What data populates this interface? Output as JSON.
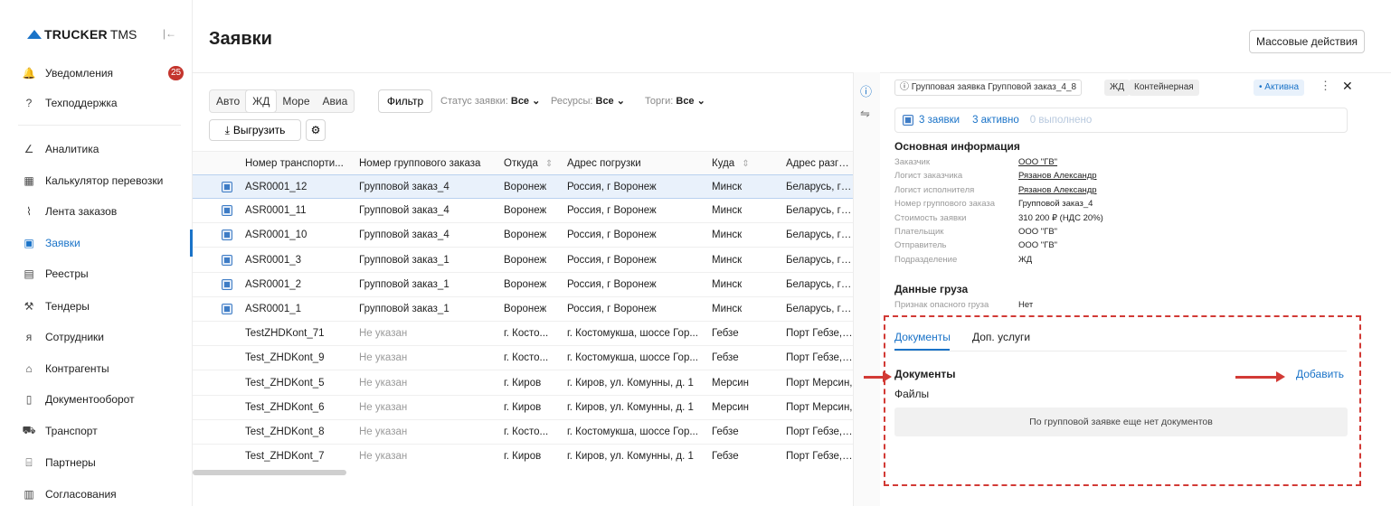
{
  "sidebar": {
    "logo_bold": "TRUCKER",
    "logo_light": "TMS",
    "collapse_icon": "|←",
    "notif_badge": "25",
    "items": [
      {
        "label": "Уведомления",
        "icon": "bell-icon",
        "glyph": "🔔"
      },
      {
        "label": "Техподдержка",
        "icon": "help-icon",
        "glyph": "?"
      },
      {
        "label": "Аналитика",
        "icon": "chart-icon",
        "glyph": "∠"
      },
      {
        "label": "Калькулятор перевозки",
        "icon": "calculator-icon",
        "glyph": "▦"
      },
      {
        "label": "Лента заказов",
        "icon": "feed-icon",
        "glyph": "⌇"
      },
      {
        "label": "Заявки",
        "icon": "requests-icon",
        "glyph": "▣",
        "active": true
      },
      {
        "label": "Реестры",
        "icon": "registry-icon",
        "glyph": "▤"
      },
      {
        "label": "Тендеры",
        "icon": "tender-icon",
        "glyph": "⚒"
      },
      {
        "label": "Сотрудники",
        "icon": "employee-icon",
        "glyph": "ᴙ"
      },
      {
        "label": "Контрагенты",
        "icon": "counterparty-icon",
        "glyph": "⌂"
      },
      {
        "label": "Документооборот",
        "icon": "document-icon",
        "glyph": "▯"
      },
      {
        "label": "Транспорт",
        "icon": "truck-icon",
        "glyph": "⛟"
      },
      {
        "label": "Партнеры",
        "icon": "partner-icon",
        "glyph": "⌸"
      },
      {
        "label": "Согласования",
        "icon": "approval-icon",
        "glyph": "▥"
      }
    ]
  },
  "header": {
    "title": "Заявки",
    "mass_actions": "Массовые действия"
  },
  "filters": {
    "modes": [
      "Авто",
      "ЖД",
      "Море",
      "Авиа"
    ],
    "active_mode": "ЖД",
    "filter_btn": "Фильтр",
    "status_label": "Статус заявки:",
    "status_value": "Все",
    "resources_label": "Ресурсы:",
    "resources_value": "Все",
    "auctions_label": "Торги:",
    "auctions_value": "Все",
    "export_btn": "Выгрузить"
  },
  "table": {
    "columns": [
      "Номер транспорти...",
      "Номер группового заказа",
      "Откуда",
      "Адрес погрузки",
      "Куда",
      "Адрес разгруз"
    ],
    "rows": [
      {
        "group": true,
        "sel": true,
        "c": [
          "ASR0001_12",
          "Групповой заказ_4",
          "Воронеж",
          "Россия, г Воронеж",
          "Минск",
          "Беларусь, г Ми"
        ]
      },
      {
        "group": true,
        "c": [
          "ASR0001_11",
          "Групповой заказ_4",
          "Воронеж",
          "Россия, г Воронеж",
          "Минск",
          "Беларусь, г Ми"
        ]
      },
      {
        "group": true,
        "c": [
          "ASR0001_10",
          "Групповой заказ_4",
          "Воронеж",
          "Россия, г Воронеж",
          "Минск",
          "Беларусь, г Ми"
        ]
      },
      {
        "group": true,
        "c": [
          "ASR0001_3",
          "Групповой заказ_1",
          "Воронеж",
          "Россия, г Воронеж",
          "Минск",
          "Беларусь, г Ми"
        ]
      },
      {
        "group": true,
        "c": [
          "ASR0001_2",
          "Групповой заказ_1",
          "Воронеж",
          "Россия, г Воронеж",
          "Минск",
          "Беларусь, г Ми"
        ]
      },
      {
        "group": true,
        "c": [
          "ASR0001_1",
          "Групповой заказ_1",
          "Воронеж",
          "Россия, г Воронеж",
          "Минск",
          "Беларусь, г Ми"
        ]
      },
      {
        "group": false,
        "c": [
          "TestZHDKont_71",
          "Не указан",
          "г. Косто...",
          "г. Костомукша, шоссе Гор...",
          "Гебзе",
          "Порт Гебзе, Ту"
        ]
      },
      {
        "group": false,
        "c": [
          "Test_ZHDKont_9",
          "Не указан",
          "г. Косто...",
          "г. Костомукша, шоссе Гор...",
          "Гебзе",
          "Порт Гебзе, Ту"
        ]
      },
      {
        "group": false,
        "c": [
          "Test_ZHDKont_5",
          "Не указан",
          "г. Киров",
          "г. Киров, ул. Комунны, д. 1",
          "Мерсин",
          "Порт Мерсин,"
        ]
      },
      {
        "group": false,
        "c": [
          "Test_ZHDKont_6",
          "Не указан",
          "г. Киров",
          "г. Киров, ул. Комунны, д. 1",
          "Мерсин",
          "Порт Мерсин,"
        ]
      },
      {
        "group": false,
        "c": [
          "Test_ZHDKont_8",
          "Не указан",
          "г. Косто...",
          "г. Костомукша, шоссе Гор...",
          "Гебзе",
          "Порт Гебзе, Ту"
        ]
      },
      {
        "group": false,
        "c": [
          "Test_ZHDKont_7",
          "Не указан",
          "г. Киров",
          "г. Киров, ул. Комунны, д. 1",
          "Гебзе",
          "Порт Гебзе, Ту"
        ]
      }
    ]
  },
  "panel": {
    "title_chip": "Групповая заявка Групповой заказ_4_8",
    "mode_chip": "ЖД",
    "type_chip": "Контейнерная",
    "status_chip": "• Активна",
    "stats": {
      "requests": "3 заявки",
      "active": "3 активно",
      "done": "0 выполнено"
    },
    "main_info_title": "Основная информация",
    "main_info": [
      {
        "k": "Заказчик",
        "v": "ООО \"ГВ\"",
        "link": true
      },
      {
        "k": "Логист заказчика",
        "v": "Рязанов Александр",
        "link": true
      },
      {
        "k": "Логист исполнителя",
        "v": "Рязанов Александр",
        "link": true
      },
      {
        "k": "Номер группового заказа",
        "v": "Групповой заказ_4",
        "link": false
      },
      {
        "k": "Стоимость заявки",
        "v": "310 200 ₽ (НДС 20%)",
        "link": false
      },
      {
        "k": "Плательщик",
        "v": "ООО \"ГВ\"",
        "link": false
      },
      {
        "k": "Отправитель",
        "v": "ООО \"ГВ\"",
        "link": false
      },
      {
        "k": "Подразделение",
        "v": "ЖД",
        "link": false
      }
    ],
    "cargo_title": "Данные груза",
    "cargo": [
      {
        "k": "Признак опасного груза",
        "v": "Нет"
      }
    ],
    "tabs": [
      "Документы",
      "Доп. услуги"
    ],
    "docs_title": "Документы",
    "add_label": "Добавить",
    "files_label": "Файлы",
    "empty_text": "По групповой заявке еще нет документов"
  },
  "colors": {
    "accent": "#1a73c8",
    "annotation_red": "#d23a35",
    "badge": "#c4352d"
  }
}
